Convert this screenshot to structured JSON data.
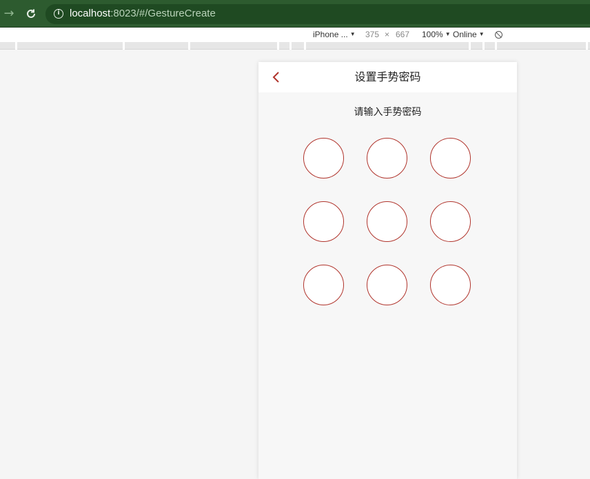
{
  "browser": {
    "url_host": "localhost",
    "url_rest": ":8023/#/GestureCreate",
    "forward_icon": "arrow-right-icon",
    "reload_icon": "reload-icon",
    "info_icon": "info-icon"
  },
  "device_toolbar": {
    "device": "iPhone ...",
    "width": "375",
    "times": "×",
    "height": "667",
    "zoom": "100%",
    "network": "Online"
  },
  "app": {
    "title": "设置手势密码",
    "prompt": "请输入手势密码",
    "back_icon": "chevron-left-icon",
    "accent_color": "#b0332b",
    "gesture_dot_count": 9
  }
}
